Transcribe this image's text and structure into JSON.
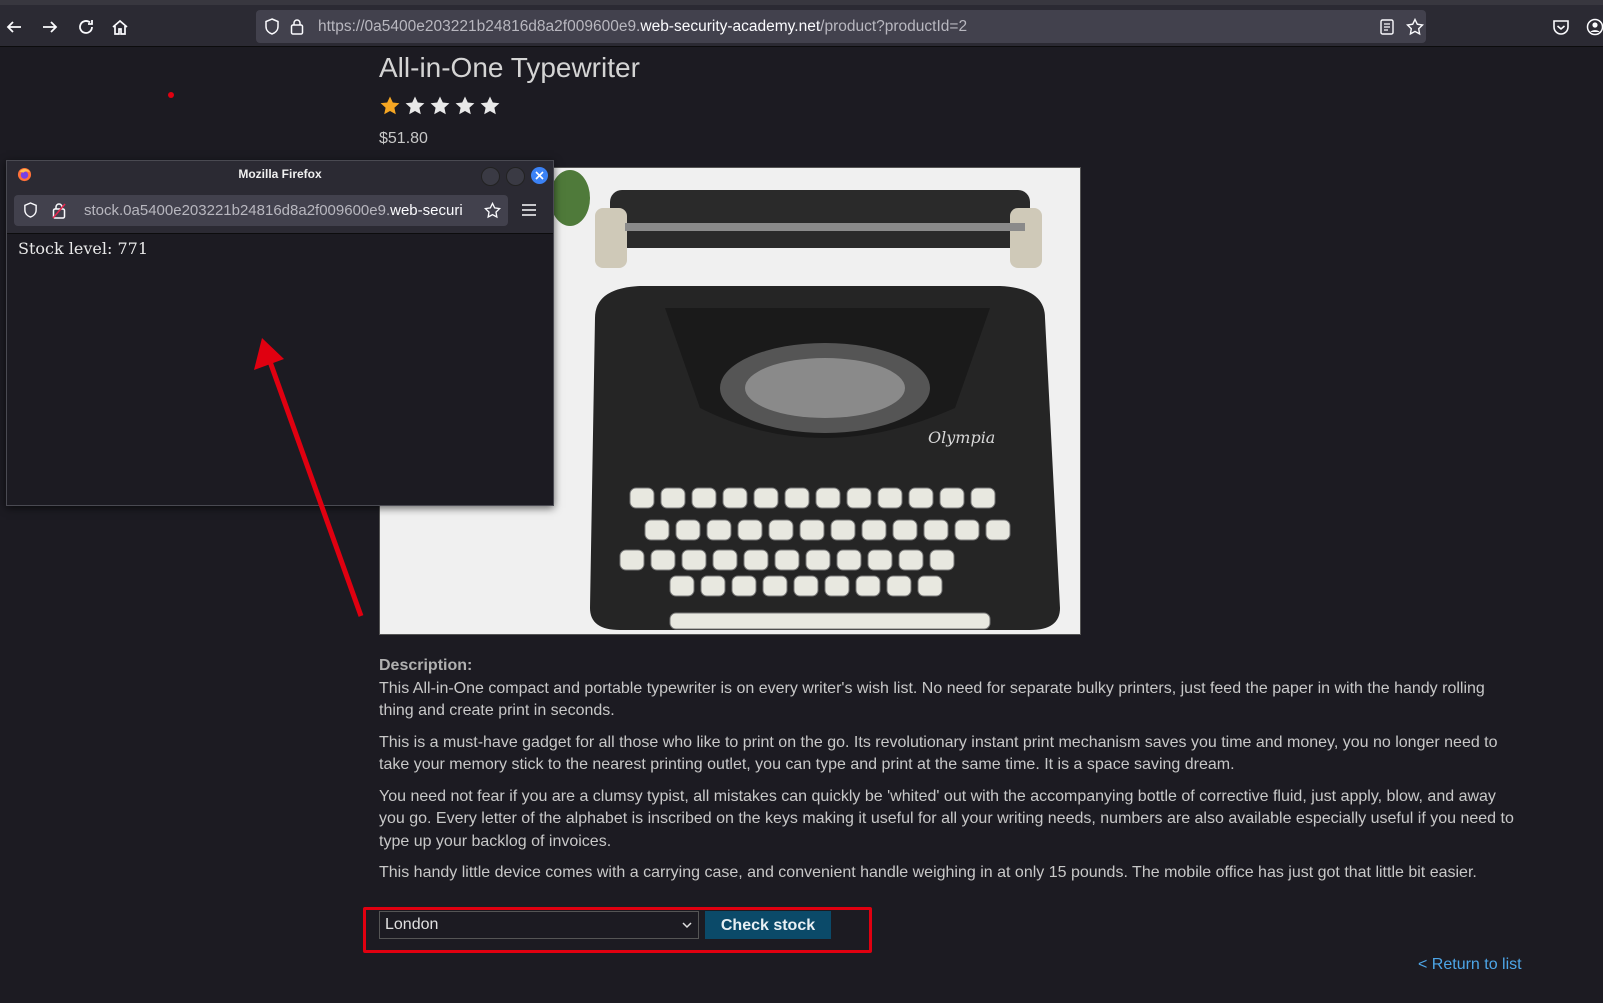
{
  "browser": {
    "url_prefix": "https://0a5400e203221b24816d8a2f009600e9.",
    "url_domain": "web-security-academy.net",
    "url_path": "/product?productId=2"
  },
  "product": {
    "title": "All-in-One Typewriter",
    "rating": 1,
    "rating_max": 5,
    "price": "$51.80",
    "description_label": "Description:",
    "paragraphs": [
      "This All-in-One compact and portable typewriter is on every writer's wish list. No need for separate bulky printers, just feed the paper in with the handy rolling thing and create print in seconds.",
      "This is a must-have gadget for all those who like to print on the go. Its revolutionary instant print mechanism saves you time and money, you no longer need to take your memory stick to the nearest printing outlet, you can type and print at the same time. It is a space saving dream.",
      "You need not fear if you are a clumsy typist, all mistakes can quickly be 'whited' out with the accompanying bottle of corrective fluid, just apply, blow, and away you go. Every letter of the alphabet is inscribed on the keys making it useful for all your writing needs, numbers are also available especially useful if you need to type up your backlog of invoices.",
      "This handy little device comes with a carrying case, and convenient handle weighing in at only 15 pounds. The mobile office has just got that little bit easier."
    ]
  },
  "stock_form": {
    "selected_store": "London",
    "button_label": "Check stock"
  },
  "return_link": "< Return to list",
  "popup": {
    "window_title": "Mozilla Firefox",
    "url_prefix": "stock.0a5400e203221b24816d8a2f009600e9.",
    "url_domain": "web-securi",
    "stock_text": "Stock level: 771"
  },
  "colors": {
    "page_bg": "#1c1b22",
    "accent_button": "#0b4a69",
    "annotation_red": "#e00010",
    "link": "#4da6e8",
    "star_filled": "#f5a623"
  }
}
